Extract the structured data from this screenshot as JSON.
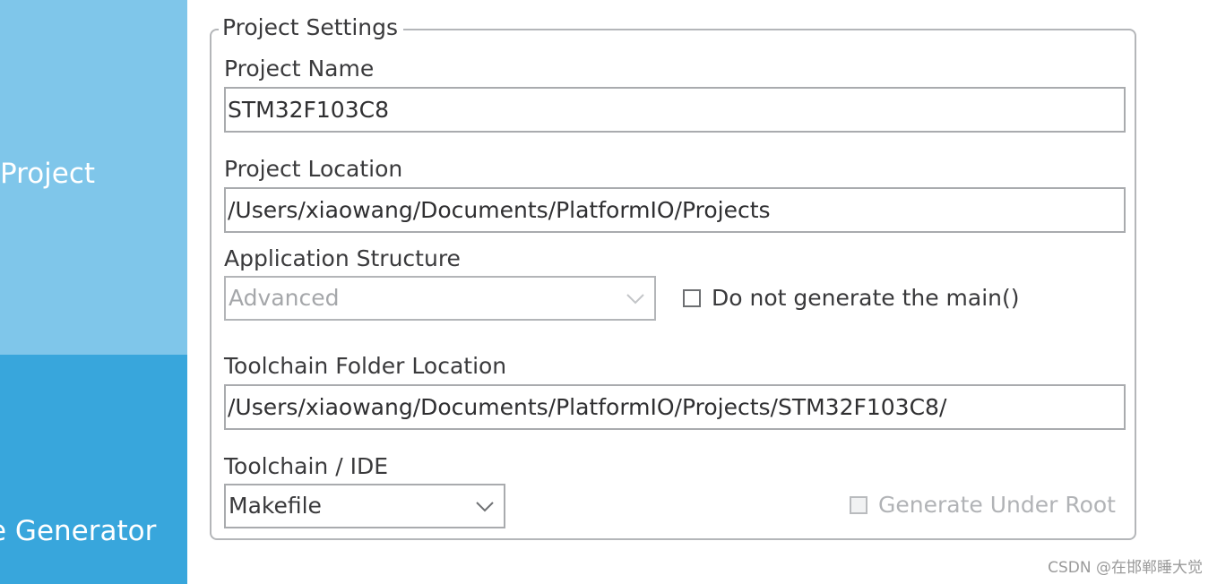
{
  "nav": {
    "tabs": [
      {
        "label": "Project"
      },
      {
        "label": "e Generator"
      }
    ]
  },
  "project_settings": {
    "title": "Project Settings",
    "project_name": {
      "label": "Project Name",
      "value": "STM32F103C8"
    },
    "project_location": {
      "label": "Project Location",
      "value": "/Users/xiaowang/Documents/PlatformIO/Projects"
    },
    "application_structure": {
      "label": "Application Structure",
      "selected": "Advanced",
      "do_not_generate_main": {
        "label": "Do not generate the main()",
        "checked": false
      }
    },
    "toolchain_folder_location": {
      "label": "Toolchain Folder Location",
      "value": "/Users/xiaowang/Documents/PlatformIO/Projects/STM32F103C8/"
    },
    "toolchain_ide": {
      "label": "Toolchain / IDE",
      "selected": "Makefile",
      "generate_under_root": {
        "label": "Generate Under Root",
        "checked": false
      }
    }
  },
  "watermark": "CSDN @在邯郸睡大觉",
  "colors": {
    "nav_tab_light": "#7fc6ea",
    "nav_tab_active": "#38a6dc",
    "border": "#a9abae",
    "disabled_text": "#a5a7aa"
  }
}
